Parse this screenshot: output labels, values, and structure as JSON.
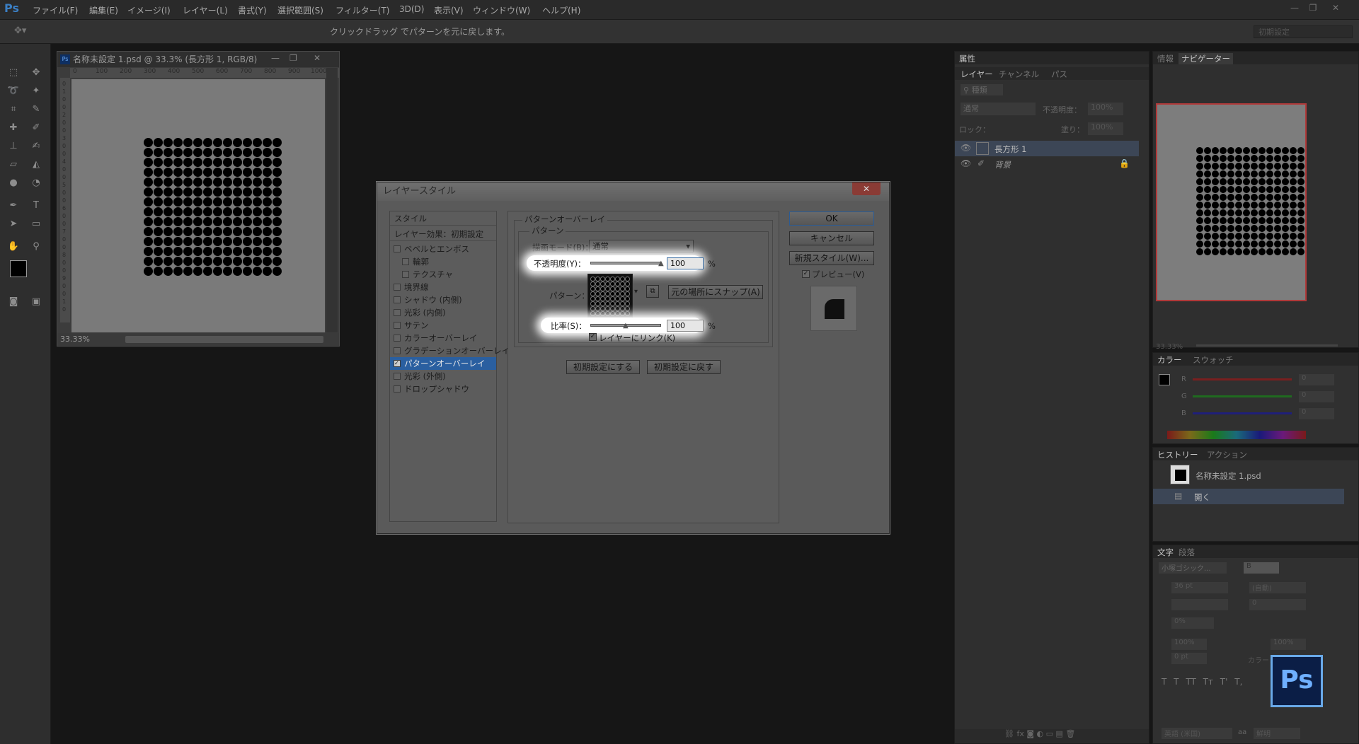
{
  "app": {
    "logo": "Ps",
    "accent": "#3b7fc4"
  },
  "menu": [
    "ファイル(F)",
    "編集(E)",
    "イメージ(I)",
    "レイヤー(L)",
    "書式(Y)",
    "選択範囲(S)",
    "フィルター(T)",
    "3D(D)",
    "表示(V)",
    "ウィンドウ(W)",
    "ヘルプ(H)"
  ],
  "window_controls": {
    "minimize": "—",
    "restore": "❐",
    "close": "✕"
  },
  "options_bar": {
    "hint": "クリックドラッグ でパターンを元に戻します。",
    "preset": "初期設定"
  },
  "document": {
    "title": "名称未設定 1.psd @ 33.3% (長方形 1, RGB/8)",
    "ruler_h": [
      "0",
      "100",
      "200",
      "300",
      "400",
      "500",
      "600",
      "700",
      "800",
      "900",
      "1000"
    ],
    "ruler_v": [
      "0",
      "1",
      "0",
      "0",
      "2",
      "0",
      "0",
      "3",
      "0",
      "0",
      "4",
      "0",
      "0",
      "5",
      "0",
      "0",
      "6",
      "0",
      "0",
      "7",
      "0",
      "0",
      "8",
      "0",
      "0",
      "9",
      "0",
      "0",
      "1",
      "0"
    ],
    "zoom": "33.33%",
    "grid_rows": 14,
    "grid_cols": 14
  },
  "dialog": {
    "title": "レイヤースタイル",
    "close": "✕",
    "styles_header": "スタイル",
    "effects_header": "レイヤー効果：初期設定",
    "items": [
      {
        "label": "ベベルとエンボス",
        "checked": false,
        "indent": false
      },
      {
        "label": "輪郭",
        "checked": false,
        "indent": true
      },
      {
        "label": "テクスチャ",
        "checked": false,
        "indent": true
      },
      {
        "label": "境界線",
        "checked": false,
        "indent": false
      },
      {
        "label": "シャドウ (内側)",
        "checked": false,
        "indent": false
      },
      {
        "label": "光彩 (内側)",
        "checked": false,
        "indent": false
      },
      {
        "label": "サテン",
        "checked": false,
        "indent": false
      },
      {
        "label": "カラーオーバーレイ",
        "checked": false,
        "indent": false
      },
      {
        "label": "グラデーションオーバーレイ",
        "checked": false,
        "indent": false
      },
      {
        "label": "パターンオーバーレイ",
        "checked": true,
        "indent": false,
        "selected": true
      },
      {
        "label": "光彩 (外側)",
        "checked": false,
        "indent": false
      },
      {
        "label": "ドロップシャドウ",
        "checked": false,
        "indent": false
      }
    ],
    "group_title": "パターンオーバーレイ",
    "subgroup_title": "パターン",
    "blend_label": "描画モード(B)：",
    "blend_value": "通常",
    "opacity_label": "不透明度(Y)：",
    "opacity_value": "100",
    "opacity_level": 1.0,
    "percent": "%",
    "pattern_label": "パターン：",
    "snap_button": "元の場所にスナップ(A)",
    "scale_label": "比率(S)：",
    "scale_value": "100",
    "scale_level": 0.5,
    "link_label": "レイヤーにリンク(K)",
    "link_checked": true,
    "default_button": "初期設定にする",
    "reset_button": "初期設定に戻す",
    "ok": "OK",
    "cancel": "キャンセル",
    "new_style": "新規スタイル(W)...",
    "preview_label": "プレビュー(V)",
    "preview_checked": true
  },
  "props_panel": {
    "title": "属性"
  },
  "layers_panel": {
    "tabs": [
      "レイヤー",
      "チャンネル",
      "パス"
    ],
    "filter": "種類",
    "blend": "通常",
    "opacity_label": "不透明度：",
    "opacity_value": "100%",
    "lock_label": "ロック：",
    "fill_label": "塗り：",
    "fill_value": "100%",
    "layers": [
      {
        "name": "長方形 1",
        "selected": true
      },
      {
        "name": "背景",
        "selected": false,
        "locked": true
      }
    ]
  },
  "navigator": {
    "tabs": [
      "情報",
      "ナビゲーター"
    ],
    "zoom": "33.33%"
  },
  "color_panel": {
    "tabs": [
      "カラー",
      "スウォッチ"
    ],
    "channels": [
      {
        "label": "R",
        "value": "0",
        "color": "#b22"
      },
      {
        "label": "G",
        "value": "0",
        "color": "#2a2"
      },
      {
        "label": "B",
        "value": "0",
        "color": "#22b"
      }
    ]
  },
  "history_panel": {
    "tabs": [
      "ヒストリー",
      "アクション"
    ],
    "snapshot": "名称未設定 1.psd",
    "items": [
      "開く"
    ]
  },
  "char_panel": {
    "tabs": [
      "文字",
      "段落"
    ],
    "font": "小塚ゴシック...",
    "style": "B",
    "size": "36 pt",
    "leading": "(自動)",
    "kerning": "",
    "tracking": "0",
    "scale_pct": "0%",
    "v_scale": "100%",
    "h_scale": "100%",
    "baseline": "0 pt",
    "color_label": "カラー：",
    "lang": "英語 (米国)",
    "aa_label": "aa",
    "aa_value": "鮮明",
    "styles": [
      "T",
      "T",
      "TT",
      "Tт",
      "T'",
      "T,"
    ]
  },
  "colors": {
    "fg": "#000000",
    "bg": "#d0d0d0",
    "selection": "#2a5fa0"
  }
}
